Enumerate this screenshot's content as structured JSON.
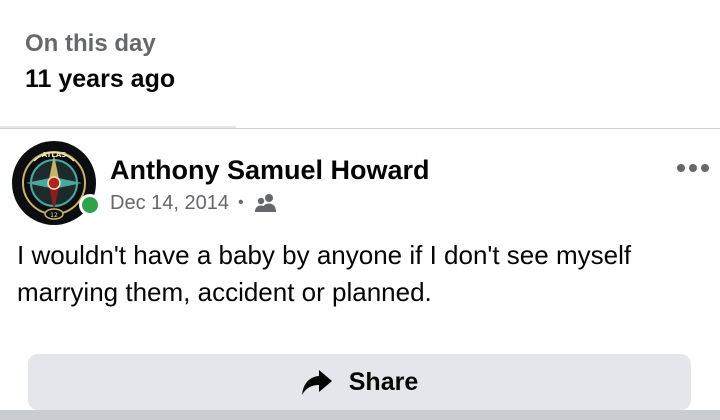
{
  "memory": {
    "label": "On this day",
    "years_ago": "11 years ago"
  },
  "post": {
    "author": "Anthony Samuel Howard",
    "date": "Dec 14, 2014",
    "separator": "•",
    "audience_icon": "friends-icon",
    "online": true,
    "text": "I wouldn't have a baby by anyone if I don't see myself marrying them, accident or planned.",
    "avatar_text": {
      "top": "ATLAS",
      "bottom": "12"
    }
  },
  "actions": {
    "share_label": "Share",
    "share_icon": "share-arrow-icon",
    "more_icon": "more-options-icon"
  },
  "colors": {
    "primary_text": "#050505",
    "secondary_text": "#65676b",
    "button_bg": "#e4e6eb",
    "online_green": "#31a24c"
  }
}
